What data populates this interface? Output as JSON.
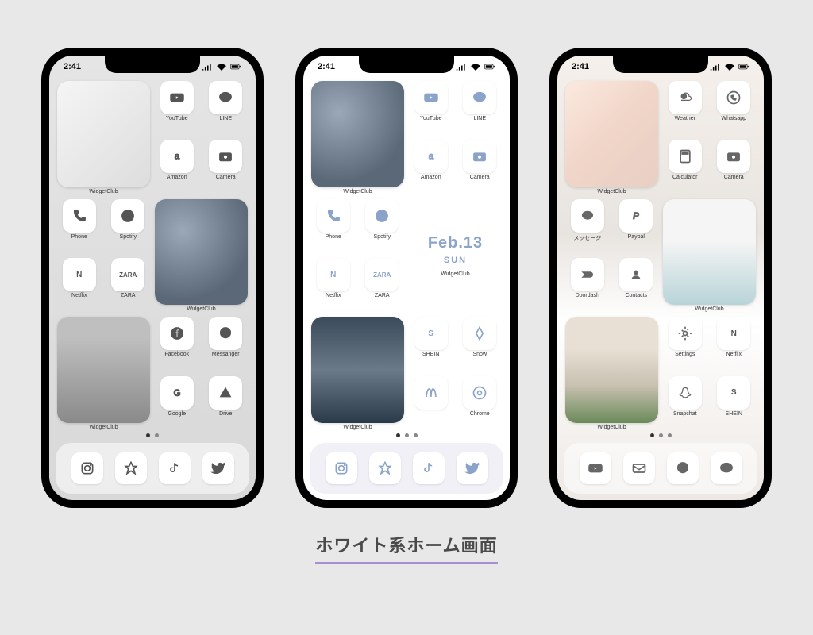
{
  "status": {
    "time": "2:41"
  },
  "caption": "ホワイト系ホーム画面",
  "labels": {
    "widgetclub": "WidgetClub",
    "youtube": "YouTube",
    "line": "LINE",
    "amazon": "Amazon",
    "camera": "Camera",
    "phone": "Phone",
    "spotify": "Spotify",
    "netflix": "Netflix",
    "zara": "ZARA",
    "facebook": "Facebook",
    "messenger": "Messanger",
    "google": "Google",
    "drive": "Drive",
    "shein": "SHEIN",
    "snow": "Snow",
    "mcdonalds": "",
    "chrome": "Chrome",
    "weather": "Weather",
    "whatsapp": "Whatsapp",
    "calculator": "Calculator",
    "messages": "メッセージ",
    "paypal": "Paypal",
    "doordash": "Doordash",
    "contacts": "Contacts",
    "settings": "Settings",
    "snapchat": "Snapchat"
  },
  "zara_text": "ZARA",
  "n_text": "N",
  "s_text": "S",
  "date": {
    "main": "Feb.13",
    "sub": "SUN"
  }
}
